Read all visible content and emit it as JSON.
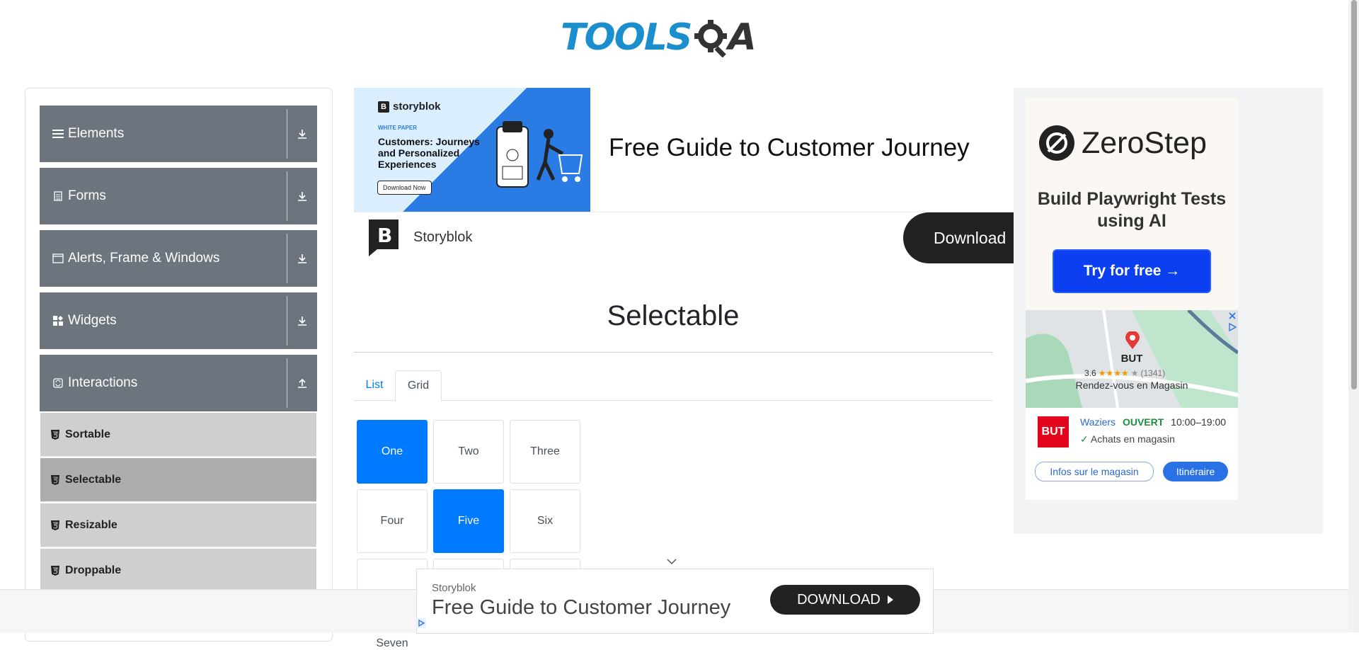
{
  "header": {
    "logo_part1": "TOOLS",
    "logo_part2": "A"
  },
  "sidebar": {
    "groups": [
      {
        "label": "Elements",
        "icon": "menu-icon"
      },
      {
        "label": "Forms",
        "icon": "document-icon"
      },
      {
        "label": "Alerts, Frame & Windows",
        "icon": "window-icon"
      },
      {
        "label": "Widgets",
        "icon": "grid-icon"
      },
      {
        "label": "Interactions",
        "icon": "refresh-icon"
      }
    ],
    "items": [
      {
        "label": "Sortable"
      },
      {
        "label": "Selectable"
      },
      {
        "label": "Resizable"
      },
      {
        "label": "Droppable"
      }
    ]
  },
  "topad": {
    "brand": "storyblok",
    "whitepaper": "WHITE PAPER",
    "image_headline": "Customers: Journeys and Personalized Experiences",
    "image_button": "Download Now",
    "headline": "Free Guide to Customer Journey",
    "brand_name": "Storyblok",
    "download": "Download"
  },
  "main": {
    "title": "Selectable",
    "tabs": [
      "List",
      "Grid"
    ],
    "grid": [
      "One",
      "Two",
      "Three",
      "Four",
      "Five",
      "Six",
      "Seven"
    ]
  },
  "rightad": {
    "brand": "ZeroStep",
    "tagline": "Build Playwright Tests using AI",
    "cta": "Try for free →",
    "map_place": "BUT",
    "map_rating": "3.6",
    "map_reviews": "(1341)",
    "map_caption": "Rendez-vous en Magasin",
    "store_logo": "BUT",
    "store_city": "Waziers",
    "store_status": "OUVERT",
    "store_hours": "10:00–19:00",
    "store_feature": "Achats en magasin",
    "btn_info": "Infos sur le magasin",
    "btn_route": "Itinéraire"
  },
  "bottomad": {
    "brand": "Storyblok",
    "headline": "Free Guide to Customer Journey",
    "cta": "DOWNLOAD"
  },
  "colors": {
    "accent": "#007bff",
    "sidebar_group": "#6c757d",
    "logo_blue": "#1b8fce"
  }
}
